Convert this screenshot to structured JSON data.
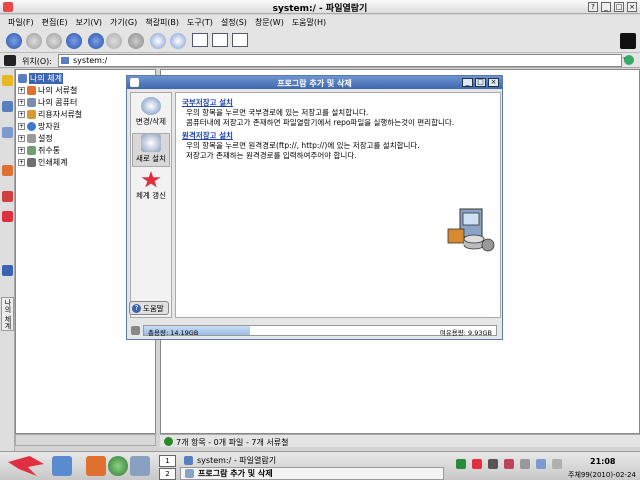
{
  "window": {
    "title": "system:/ - 파일열람기"
  },
  "menu": [
    "파일(F)",
    "편집(E)",
    "보기(V)",
    "가기(G)",
    "책갈피(B)",
    "도구(T)",
    "설정(S)",
    "창문(W)",
    "도움말(H)"
  ],
  "location": {
    "label": "위치(O):",
    "value": "system:/"
  },
  "side_tab_label": "나의 체계",
  "tree": {
    "items": [
      {
        "label": "나의 체계",
        "expander": "",
        "icon_color": "#5a7fc0",
        "selected": true
      },
      {
        "label": "나의 서류철",
        "expander": "+",
        "icon_color": "#e07030"
      },
      {
        "label": "나의 콤퓨터",
        "expander": "+",
        "icon_color": "#7a8fb0"
      },
      {
        "label": "리용자서류철",
        "expander": "+",
        "icon_color": "#d89a30"
      },
      {
        "label": "망자원",
        "expander": "+",
        "icon_color": "#3a7ad0"
      },
      {
        "label": "설정",
        "expander": "+",
        "icon_color": "#9a9a9a"
      },
      {
        "label": "쥐수통",
        "expander": "+",
        "icon_color": "#70a070"
      },
      {
        "label": "인쇄체계",
        "expander": "+",
        "icon_color": "#707070"
      }
    ]
  },
  "statusbar": {
    "text": "7개 항목 - 0개 파일 - 7개 서류철"
  },
  "dialog": {
    "title": "프로그람 추가 및 삭제",
    "nav": [
      {
        "label": "변경/삭제",
        "icon_color": "#6a8fc0"
      },
      {
        "label": "새로 설치",
        "icon_color": "#8aa0c0"
      },
      {
        "label": "체계 갱신",
        "icon_color": "#e03040"
      }
    ],
    "help_label": "도움말",
    "sections": [
      {
        "heading": "국부저장고 설치",
        "lines": [
          "우의 항목을 누르면 국부경로에 있는 저장고를 설치합니다.",
          "콤퓨터내에 저장고가 존재하면 파일열람기에서 repo파일을 실행하는것이 편리합니다."
        ]
      },
      {
        "heading": "원격저장고 설치",
        "lines": [
          "우의 항목을 누르면 원격경로(ftp://, http://)에 있는 저장고를 설치합니다.",
          "저장고가 존재하는 원격경로를 입력하여주어야 합니다."
        ]
      }
    ],
    "disk": {
      "used_label": "총용량: 14.19GB",
      "free_label": "여유용량: 9.93GB",
      "used_fraction": 0.3
    }
  },
  "taskbar": {
    "workspaces": [
      "1",
      "2"
    ],
    "tasks": [
      {
        "label": "system:/ - 파일열람기",
        "active": false
      },
      {
        "label": "프로그람 추가 및 삭제",
        "active": true
      }
    ],
    "clock": "21:08",
    "date": "주체99(2010)-02-24"
  }
}
